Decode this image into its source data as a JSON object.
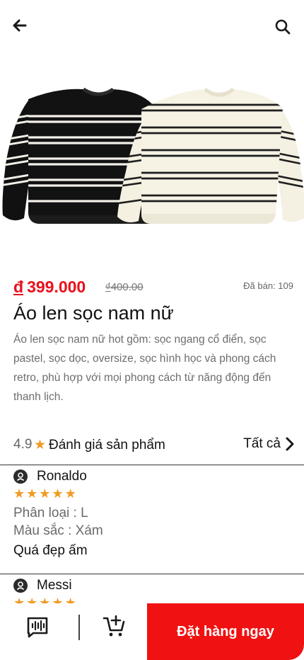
{
  "header": {
    "back_icon": "arrow-left-icon",
    "search_icon": "search-icon"
  },
  "product": {
    "image_icon": "sweaters-product-photo",
    "currency_symbol": "đ",
    "price": "399.000",
    "old_price_currency": "₫",
    "old_price": "400.00",
    "sold_text": "Đã bán: 109",
    "title": "Áo len sọc nam nữ",
    "description": "Áo len sọc nam nữ hot gồm: sọc ngang cổ điển, sọc pastel, sọc dọc, oversize, sọc hình học và phong cách retro, phù hợp với mọi phong cách từ năng động đến thanh lịch."
  },
  "rating": {
    "score": "4.9",
    "star": "★",
    "label": "Đánh giá sản phẩm",
    "all_label": "Tất cả",
    "chevron_icon": "chevron-right-icon"
  },
  "reviews": [
    {
      "name": "Ronaldo",
      "stars": 5,
      "star_glyph": "★",
      "category": "Phân loại : L",
      "color": "Màu sắc : Xám",
      "comment": "Quá đẹp ấm"
    },
    {
      "name": "Messi",
      "stars": 5,
      "star_glyph": "★"
    }
  ],
  "bottom_bar": {
    "chat_icon": "voice-chat-icon",
    "cart_icon": "add-to-cart-icon",
    "order_label": "Đặt hàng ngay"
  },
  "colors": {
    "accent": "#f01212",
    "price": "#e8101b",
    "star": "#f29a1f"
  }
}
